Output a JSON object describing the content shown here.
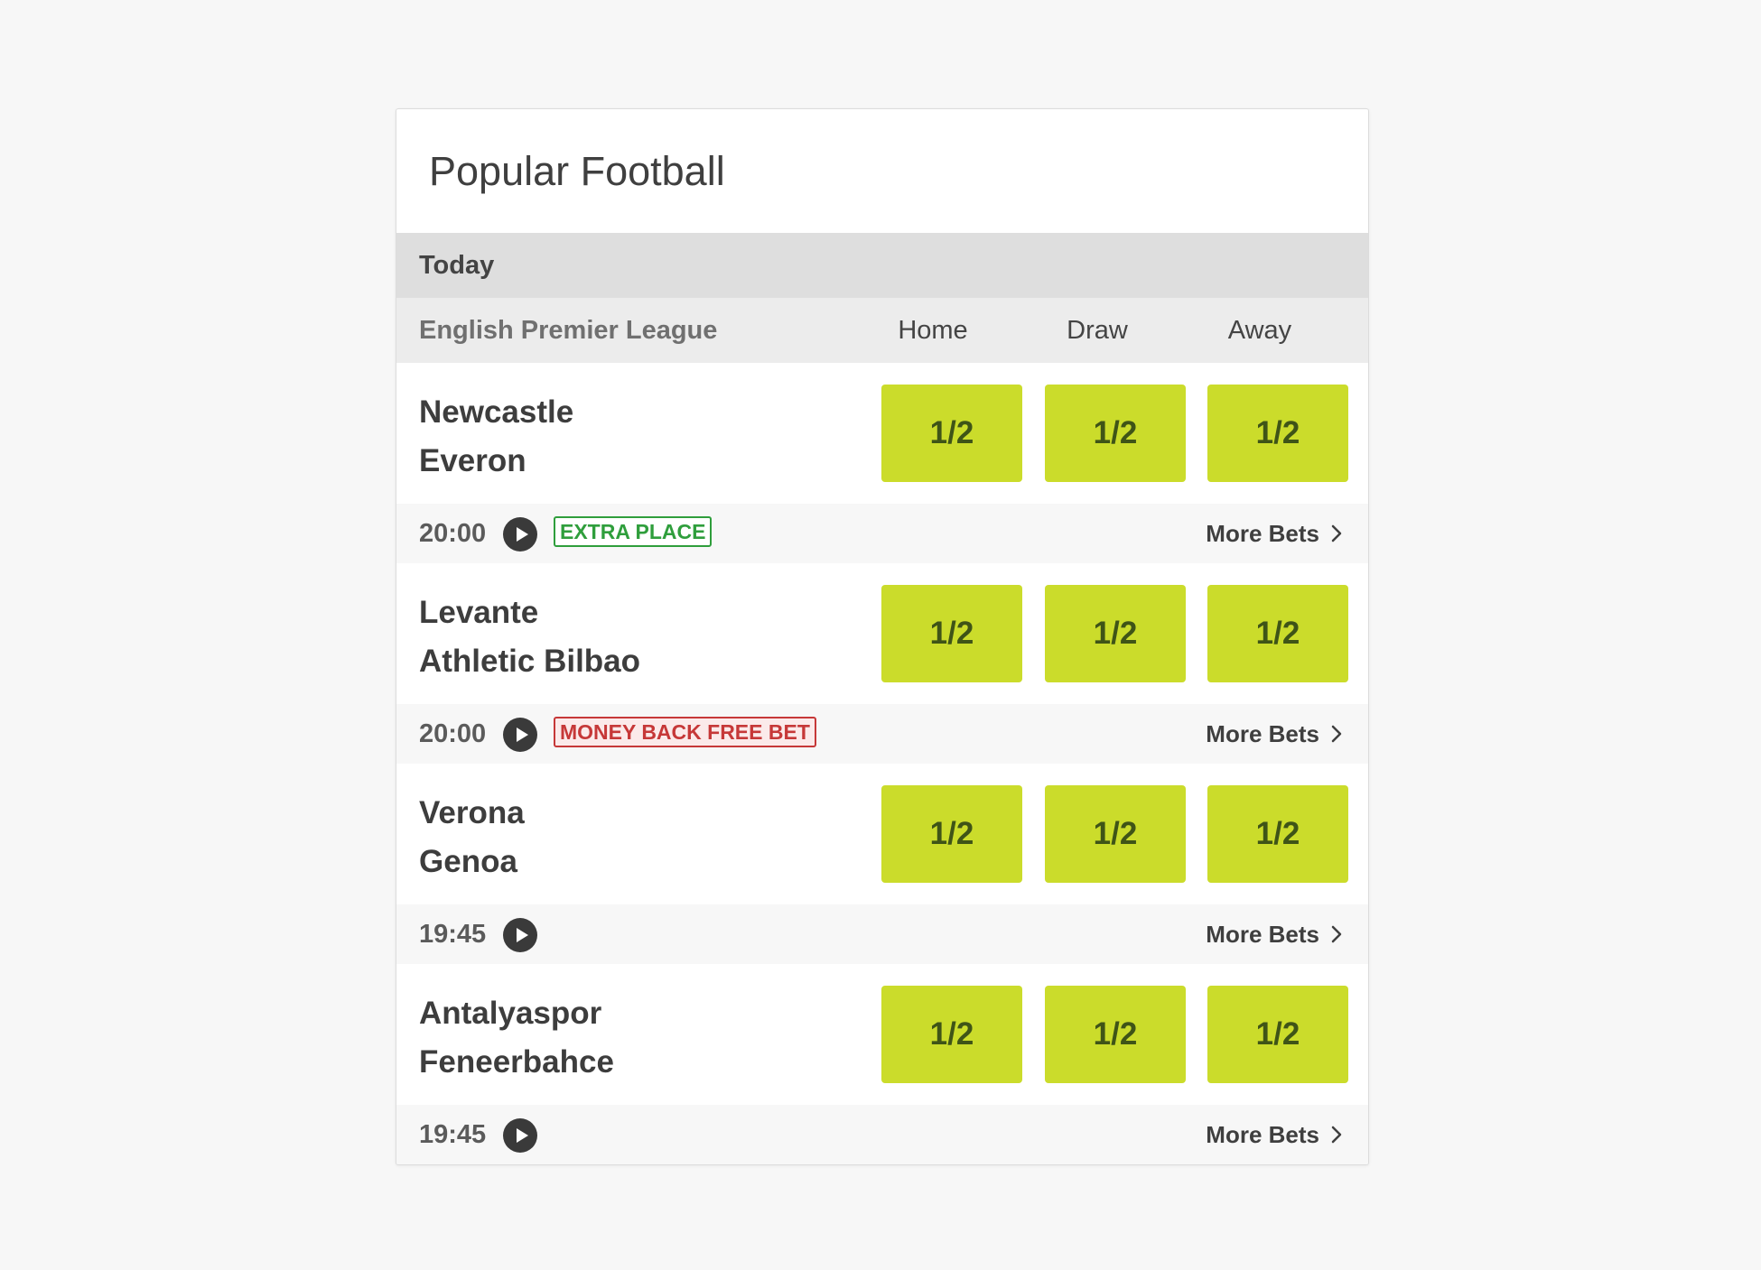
{
  "widget": {
    "title": "Popular Football",
    "day_label": "Today",
    "league": "English Premier League",
    "columns": {
      "home": "Home",
      "draw": "Draw",
      "away": "Away"
    }
  },
  "events": [
    {
      "home_team": "Newcastle",
      "away_team": "Everon",
      "odds": {
        "home": "1/2",
        "draw": "1/2",
        "away": "1/2"
      },
      "time": "20:00",
      "badge": "EXTRA PLACE",
      "badge_style": "green",
      "more_bets": "More Bets"
    },
    {
      "home_team": "Levante",
      "away_team": "Athletic Bilbao",
      "odds": {
        "home": "1/2",
        "draw": "1/2",
        "away": "1/2"
      },
      "time": "20:00",
      "badge": "MONEY BACK FREE BET",
      "badge_style": "red",
      "more_bets": "More Bets"
    },
    {
      "home_team": "Verona",
      "away_team": "Genoa",
      "odds": {
        "home": "1/2",
        "draw": "1/2",
        "away": "1/2"
      },
      "time": "19:45",
      "more_bets": "More Bets"
    },
    {
      "home_team": "Antalyaspor",
      "away_team": "Feneerbahce",
      "odds": {
        "home": "1/2",
        "draw": "1/2",
        "away": "1/2"
      },
      "time": "19:45",
      "more_bets": "More Bets"
    }
  ],
  "icons": {
    "play": "play-circle-icon",
    "chevron": "chevron-right-icon"
  },
  "colors": {
    "odds_button": "#cbdc2b",
    "odds_text": "#3f5417",
    "badge_green": "#2f9e3c",
    "badge_red": "#c63838"
  }
}
